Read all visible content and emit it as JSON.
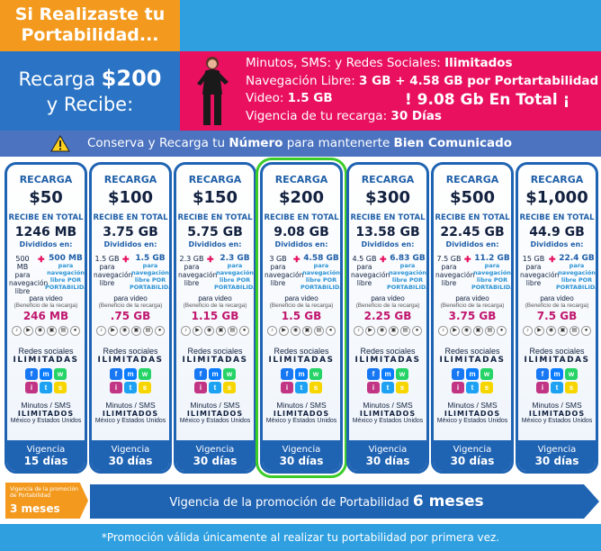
{
  "header": {
    "orange_title": "Si Realizaste tu Portabilidad...",
    "recarga_prefix": "Recarga",
    "recarga_amount": "$200",
    "recarga_suffix": "y Recibe:",
    "line1_label": "Minutos, SMS: y Redes Sociales: ",
    "line1_value": "Ilimitados",
    "line2_label": "Navegación Libre: ",
    "line2_value": "3 GB + 4.58 GB por Portartabilidad",
    "line3_label": "Video: ",
    "line3_value": "1.5 GB",
    "line4_label": "Vigencia de tu recarga: ",
    "line4_value": "30 Días",
    "total_callout": "! 9.08 Gb En Total ¡"
  },
  "warning": {
    "text_a": "Conserva y Recarga tu ",
    "text_b": "Número",
    "text_c": " para mantenerte ",
    "text_d": "Bien Comunicado"
  },
  "card_common": {
    "recarga": "RECARGA",
    "recibe": "RECIBE EN TOTAL",
    "divididos": "Divididos en:",
    "nav_libre": "para navegación libre",
    "por_port": "para navegación libre POR PORTABILIDAD",
    "para_video": "para video",
    "beneficio": "(Beneficio de la recarga)",
    "redes": "Redes sociales",
    "ilimitadas": "ILIMITADAS",
    "minutos": "Minutos / SMS",
    "ilimitados": "ILIMITADOS",
    "mexico": "México y Estados Unidos",
    "vigencia": "Vigencia"
  },
  "cards": [
    {
      "amount": "$50",
      "total": "1246 MB",
      "libre": "500 MB",
      "port": "500 MB",
      "video": "246 MB",
      "days": "15 días"
    },
    {
      "amount": "$100",
      "total": "3.75 GB",
      "libre": "1.5 GB",
      "port": "1.5 GB",
      "video": ".75 GB",
      "days": "30 días"
    },
    {
      "amount": "$150",
      "total": "5.75 GB",
      "libre": "2.3 GB",
      "port": "2.3 GB",
      "video": "1.15 GB",
      "days": "30 días"
    },
    {
      "amount": "$200",
      "total": "9.08 GB",
      "libre": "3 GB",
      "port": "4.58 GB",
      "video": "1.5 GB",
      "days": "30 días"
    },
    {
      "amount": "$300",
      "total": "13.58 GB",
      "libre": "4.5 GB",
      "port": "6.83 GB",
      "video": "2.25 GB",
      "days": "30 días"
    },
    {
      "amount": "$500",
      "total": "22.45 GB",
      "libre": "7.5 GB",
      "port": "11.2 GB",
      "video": "3.75 GB",
      "days": "30 días"
    },
    {
      "amount": "$1,000",
      "total": "44.9 GB",
      "libre": "15 GB",
      "port": "22.4 GB",
      "video": "7.5 GB",
      "days": "30 días"
    }
  ],
  "highlight_index": 3,
  "promo": {
    "left_small": "Vigencia de la promoción de Portabilidad",
    "left_big": "3 meses",
    "right_text": "Vigencia de la promoción de Portabilidad ",
    "right_big": "6 meses"
  },
  "footer": "*Promoción válida únicamente al realizar tu portabilidad por primera vez.",
  "colors": {
    "orange": "#f39a1e",
    "blue": "#2b74c5",
    "pink": "#e8105f",
    "highlight": "#3ccc28"
  }
}
